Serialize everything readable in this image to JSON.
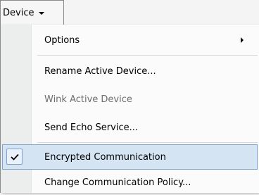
{
  "menubar": {
    "menu_label": "Device"
  },
  "dropdown": {
    "items": [
      {
        "label": "Options",
        "disabled": false,
        "checked": false,
        "has_submenu": true
      },
      {
        "label": "Rename Active Device...",
        "disabled": false,
        "checked": false,
        "has_submenu": false
      },
      {
        "label": "Wink Active Device",
        "disabled": true,
        "checked": false,
        "has_submenu": false
      },
      {
        "label": "Send Echo Service...",
        "disabled": false,
        "checked": false,
        "has_submenu": false
      },
      {
        "label": "Encrypted Communication",
        "disabled": false,
        "checked": true,
        "has_submenu": false
      },
      {
        "label": "Change Communication Policy...",
        "disabled": false,
        "checked": false,
        "has_submenu": false
      }
    ]
  },
  "colors": {
    "highlight": "#d5e4f3",
    "highlight_border": "#7da2ce",
    "gutter": "#eceded",
    "disabled_text": "#6d6d6d"
  }
}
